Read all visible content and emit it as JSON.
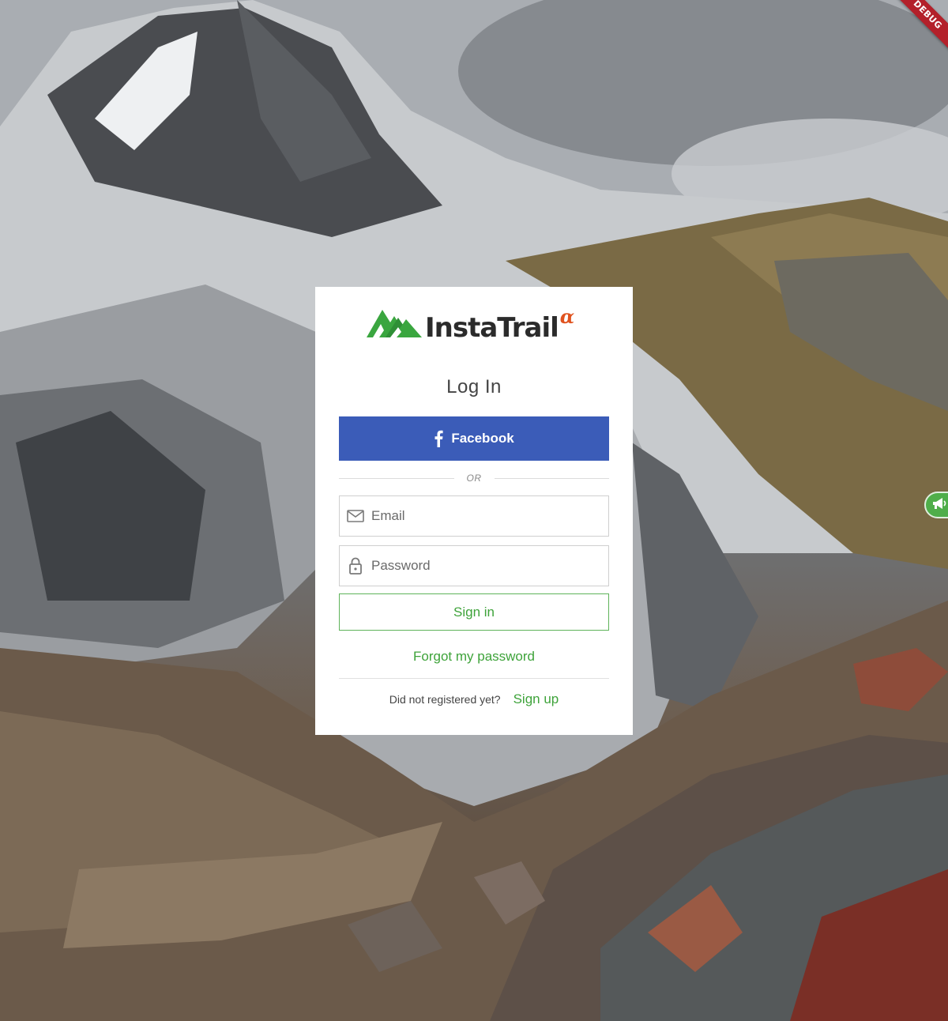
{
  "app": {
    "logo_text": "InstaTrail",
    "logo_badge": "α",
    "debug_label": "DEBUG"
  },
  "login": {
    "title": "Log In",
    "facebook_label": "Facebook",
    "or_label": "OR",
    "email_placeholder": "Email",
    "password_placeholder": "Password",
    "signin_label": "Sign in",
    "forgot_label": "Forgot my password",
    "signup_prompt": "Did not registered yet?",
    "signup_label": "Sign up"
  },
  "icons": {
    "facebook": "facebook-icon",
    "email": "mail-icon",
    "password": "lock-icon",
    "feedback": "megaphone-icon",
    "logo": "mountain-logo-icon"
  },
  "colors": {
    "facebook_blue": "#3b5cb8",
    "brand_green": "#3ea33a",
    "logo_green": "#3aa63f",
    "alpha_orange": "#e0531f",
    "debug_red": "#b3202a",
    "card_background": "#ffffff"
  }
}
